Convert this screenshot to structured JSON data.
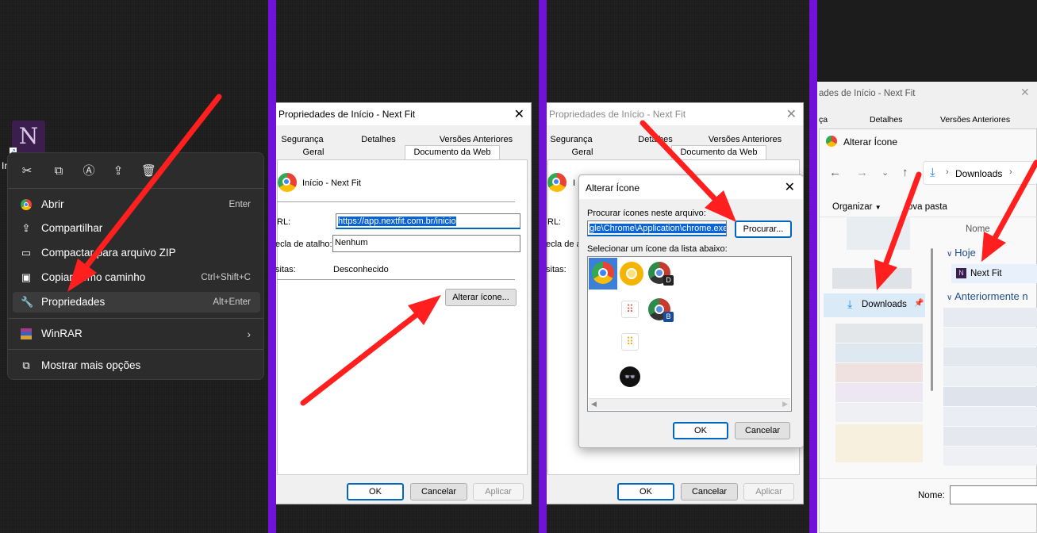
{
  "panel1": {
    "shortcut_label_partial": "In",
    "context_menu": {
      "items": [
        {
          "label": "Abrir",
          "shortcut": "Enter"
        },
        {
          "label": "Compartilhar",
          "shortcut": ""
        },
        {
          "label": "Compactar para arquivo ZIP",
          "shortcut": ""
        },
        {
          "label": "Copiar como caminho",
          "shortcut": "Ctrl+Shift+C"
        },
        {
          "label": "Propriedades",
          "shortcut": "Alt+Enter"
        },
        {
          "label": "WinRAR",
          "shortcut": ""
        },
        {
          "label": "Mostrar mais opções",
          "shortcut": ""
        }
      ]
    }
  },
  "panel2": {
    "title": "Propriedades de Início - Next Fit",
    "tabs_row1": [
      "Segurança",
      "Detalhes",
      "Versões Anteriores"
    ],
    "tabs_row2": [
      "Geral",
      "Documento da Web"
    ],
    "name": "Início - Next Fit",
    "url_label": "RL:",
    "url_value": "https://app.nextfit.com.br/inicio",
    "hotkey_label": "ecla de atalho:",
    "hotkey_value": "Nenhum",
    "visits_label": "sitas:",
    "visits_value": "Desconhecido",
    "change_icon": "Alterar ícone...",
    "ok": "OK",
    "cancel": "Cancelar",
    "apply": "Aplicar"
  },
  "panel3": {
    "title": "Propriedades de Início - Next Fit",
    "tabs_row1": [
      "Segurança",
      "Detalhes",
      "Versões Anteriores"
    ],
    "tabs_row2": [
      "Geral",
      "Documento da Web"
    ],
    "name_partial": "I",
    "url_label": "RL:",
    "hotkey_label": "ecla de a",
    "visits_label": "sitas:",
    "ok": "OK",
    "cancel": "Cancelar",
    "apply": "Aplicar",
    "dialog": {
      "title": "Alterar Ícone",
      "search_label": "Procurar ícones neste arquivo:",
      "file_value": "gle\\Chrome\\Application\\chrome.exe",
      "browse": "Procurar...",
      "list_label": "Selecionar um ícone da lista abaixo:",
      "ok": "OK",
      "cancel": "Cancelar",
      "icon_badges": [
        "D",
        "B"
      ]
    }
  },
  "panel4": {
    "bg_title": "ades de Início - Next Fit",
    "bg_tabs": [
      "ça",
      "Detalhes",
      "Versões Anteriores"
    ],
    "explorer_title": "Alterar Ícone",
    "path": "Downloads",
    "organize": "Organizar",
    "new_folder": "ova pasta",
    "col_name": "Nome",
    "group_today": "Hoje",
    "file_item": "Next Fit",
    "group_earlier": "Anteriormente n",
    "sidebar_downloads": "Downloads",
    "name_label": "Nome:"
  }
}
